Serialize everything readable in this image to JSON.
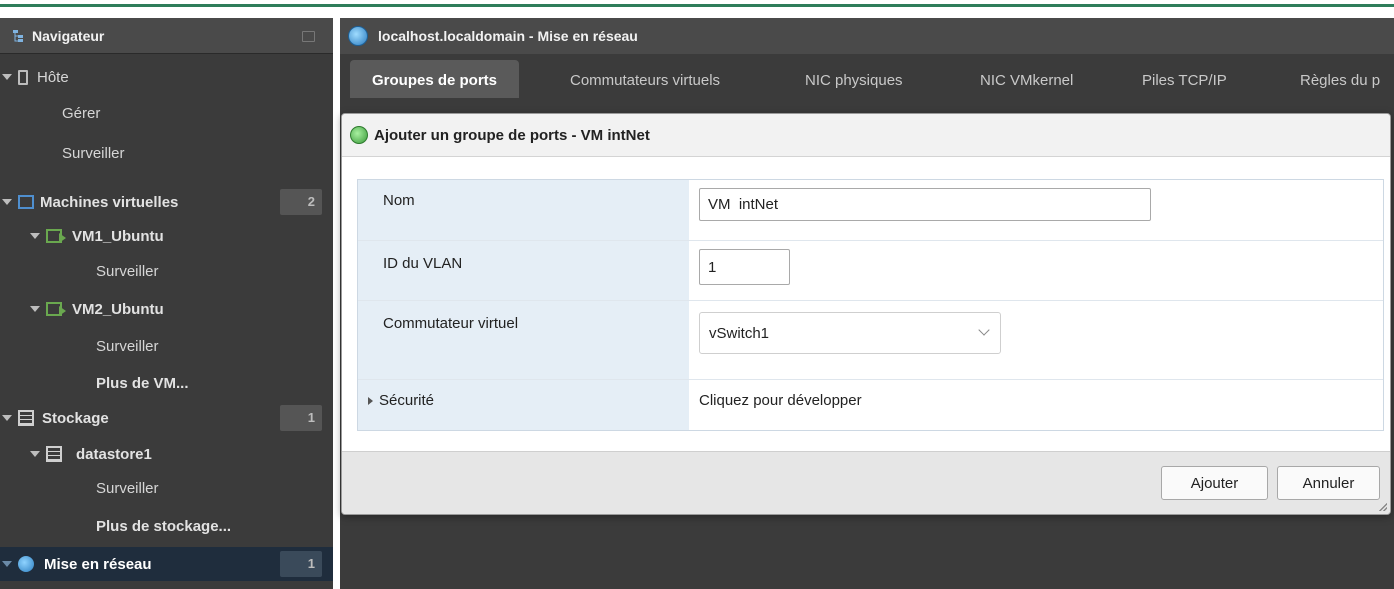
{
  "navigator": {
    "title": "Navigateur",
    "items": [
      {
        "label": "Hôte"
      },
      {
        "label": "Gérer"
      },
      {
        "label": "Surveiller"
      },
      {
        "label": "Machines virtuelles",
        "badge": "2"
      },
      {
        "label": "VM1_Ubuntu"
      },
      {
        "label": "Surveiller"
      },
      {
        "label": "VM2_Ubuntu"
      },
      {
        "label": "Surveiller"
      },
      {
        "label": "Plus de VM..."
      },
      {
        "label": "Stockage",
        "badge": "1"
      },
      {
        "label": "datastore1"
      },
      {
        "label": "Surveiller"
      },
      {
        "label": "Plus de stockage..."
      },
      {
        "label": "Mise en réseau",
        "badge": "1"
      }
    ]
  },
  "main": {
    "title": "localhost.localdomain - Mise en réseau",
    "tabs": [
      {
        "label": "Groupes de ports"
      },
      {
        "label": "Commutateurs virtuels"
      },
      {
        "label": "NIC physiques"
      },
      {
        "label": "NIC VMkernel"
      },
      {
        "label": "Piles TCP/IP"
      },
      {
        "label": "Règles du p"
      }
    ]
  },
  "dialog": {
    "title": "Ajouter un groupe de ports - VM intNet",
    "fields": {
      "name_label": "Nom",
      "name_value": "VM  intNet",
      "vlan_label": "ID du VLAN",
      "vlan_value": "1",
      "switch_label": "Commutateur virtuel",
      "switch_value": "vSwitch1",
      "security_label": "Sécurité",
      "security_value": "Cliquez pour développer"
    },
    "buttons": {
      "add": "Ajouter",
      "cancel": "Annuler"
    }
  },
  "colors": {
    "nav_bg": "#3b3b3b",
    "selected_bg": "#1f2d3d",
    "label_bg": "#e5eef6",
    "accent_green": "#2e7d5a"
  }
}
